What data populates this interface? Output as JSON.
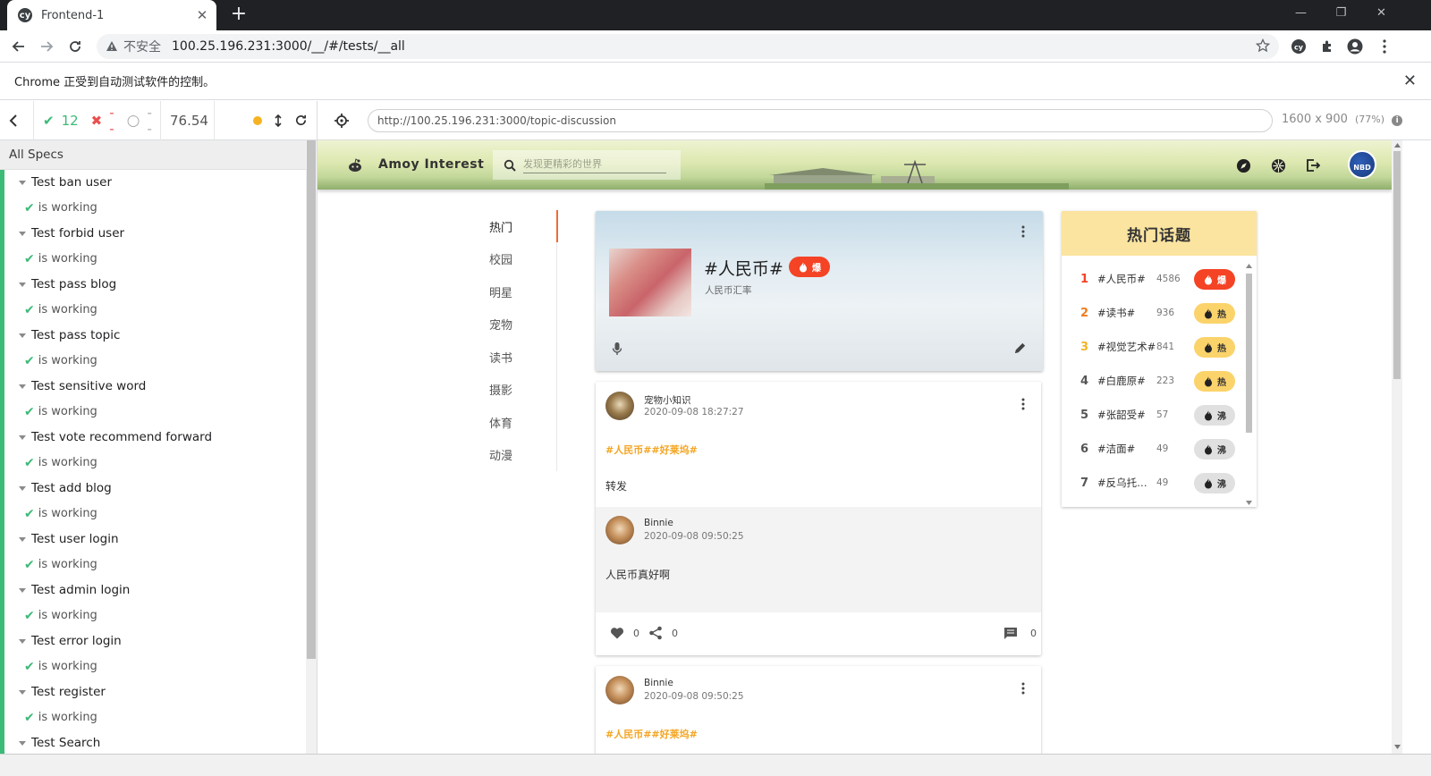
{
  "browser": {
    "tab_title": "Frontend-1",
    "tab_favicon": "cy",
    "new_tab": "+",
    "window_controls": {
      "minimize": "—",
      "restore": "❐",
      "close": "✕"
    },
    "insecure_label": "不安全",
    "url": "100.25.196.231:3000/__/#/tests/__all",
    "infobar_text": "Chrome 正受到自动测试软件的控制。",
    "infobar_close": "✕"
  },
  "runner": {
    "passed": "12",
    "failed": "--",
    "pending": "--",
    "duration": "76.54",
    "specs_header": "All Specs",
    "suites": [
      {
        "name": "Test ban user",
        "test": "is working"
      },
      {
        "name": "Test forbid user",
        "test": "is working"
      },
      {
        "name": "Test pass blog",
        "test": "is working"
      },
      {
        "name": "Test pass topic",
        "test": "is working"
      },
      {
        "name": "Test sensitive word",
        "test": "is working"
      },
      {
        "name": "Test vote recommend forward",
        "test": "is working"
      },
      {
        "name": "Test add blog",
        "test": "is working"
      },
      {
        "name": "Test user login",
        "test": "is working"
      },
      {
        "name": "Test admin login",
        "test": "is working"
      },
      {
        "name": "Test error login",
        "test": "is working"
      },
      {
        "name": "Test register",
        "test": "is working"
      },
      {
        "name": "Test Search",
        "test": ""
      }
    ],
    "aut_url": "http://100.25.196.231:3000/topic-discussion",
    "viewport": "1600 x 900",
    "scale": "(77%)"
  },
  "app": {
    "brand": "Amoy Interest",
    "search_placeholder": "发现更精彩的世界",
    "avatar_text": "NBD",
    "categories": [
      "热门",
      "校园",
      "明星",
      "宠物",
      "读书",
      "摄影",
      "体育",
      "动漫"
    ],
    "topic": {
      "name": "#人民币#",
      "desc": "人民币汇率",
      "badge": "爆"
    },
    "posts": [
      {
        "user": "宠物小知识",
        "time": "2020-09-08 18:27:27",
        "tags": "#人民币##好莱坞#",
        "text": "转发",
        "quoted": {
          "user": "Binnie",
          "time": "2020-09-08 09:50:25",
          "text": "人民币真好啊"
        },
        "likes": "0",
        "shares": "0",
        "comments": "0"
      },
      {
        "user": "Binnie",
        "time": "2020-09-08 09:50:25",
        "tags": "#人民币##好莱坞#"
      }
    ],
    "hot_title": "热门话题",
    "hot_topics": [
      {
        "rank": "1",
        "name": "#人民币#",
        "count": "4586",
        "badge": "爆",
        "color": "#f44325"
      },
      {
        "rank": "2",
        "name": "#读书#",
        "count": "936",
        "badge": "热",
        "color": "#fbd36b"
      },
      {
        "rank": "3",
        "name": "#视觉艺术#",
        "count": "841",
        "badge": "热",
        "color": "#fbd36b"
      },
      {
        "rank": "4",
        "name": "#白鹿原#",
        "count": "223",
        "badge": "热",
        "color": "#fbd36b"
      },
      {
        "rank": "5",
        "name": "#张韶受#",
        "count": "57",
        "badge": "沸",
        "color": "#e0e0e0"
      },
      {
        "rank": "6",
        "name": "#洁面#",
        "count": "49",
        "badge": "沸",
        "color": "#e0e0e0"
      },
      {
        "rank": "7",
        "name": "#反乌托…",
        "count": "49",
        "badge": "沸",
        "color": "#e0e0e0"
      }
    ],
    "rank_colors": [
      "#f44325",
      "#f07b1e",
      "#f4b324",
      "#555555",
      "#555555",
      "#555555",
      "#555555"
    ]
  }
}
